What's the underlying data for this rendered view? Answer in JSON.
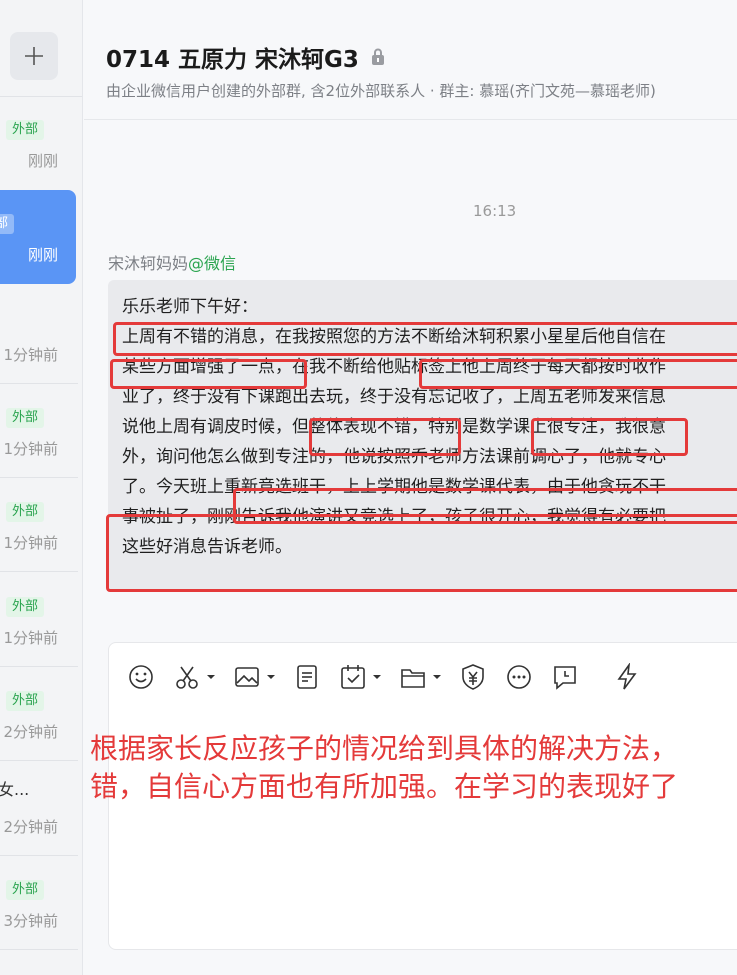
{
  "sidebar": {
    "add_label": "+",
    "items": [
      {
        "tag": "外部",
        "time": "刚刚",
        "active": false
      },
      {
        "tag": "外部",
        "time": "刚刚",
        "active": true
      },
      {
        "tag": "",
        "time": "1分钟前",
        "active": false
      },
      {
        "tag": "外部",
        "time": "1分钟前",
        "active": false
      },
      {
        "tag": "外部",
        "time": "1分钟前",
        "active": false
      },
      {
        "tag": "外部",
        "time": "1分钟前",
        "active": false
      },
      {
        "tag": "外部",
        "time": "2分钟前",
        "active": false
      },
      {
        "name": "女...",
        "tag": "",
        "time": "2分钟前",
        "active": false
      },
      {
        "tag": "外部",
        "time": "3分钟前",
        "active": false
      }
    ]
  },
  "header": {
    "title": "0714 五原力 宋沐轲G3",
    "subtitle": "由企业微信用户创建的外部群, 含2位外部联系人 · 群主: 慕瑶(齐门文苑—慕瑶老师)"
  },
  "chat": {
    "timestamp": "16:13",
    "sender_name": "宋沐轲妈妈",
    "sender_source": "@微信",
    "message_lines": [
      "乐乐老师下午好：",
      "上周有不错的消息，在我按照您的方法不断给沐轲积累小星星后他自信在",
      "某些方面增强了一点，在我不断给他贴标签上他上周终于每天都按时收作",
      "业了，终于没有下课跑出去玩，终于没有忘记收了，上周五老师发来信息",
      "说他上周有调皮时候，但整体表现不错，特别是数学课上很专注，我很意",
      "外，询问他怎么做到专注的，他说按照乔老师方法课前调心了，他就专心",
      "了。今天班上重新竞选班干，上上学期他是数学课代表，由于他贪玩不干",
      "事被扯了，刚刚告诉我他演讲又竞选上了，孩子很开心，我觉得有必要把",
      "这些好消息告诉老师。"
    ]
  },
  "input": {
    "annotation_lines": [
      "根据家长反应孩子的情况给到具体的解决方法，",
      "错，自信心方面也有所加强。在学习的表现好了"
    ]
  },
  "colors": {
    "accent": "#5a95f5",
    "external_tag": "#2aa44f",
    "annotation_red": "#e43a3a"
  }
}
